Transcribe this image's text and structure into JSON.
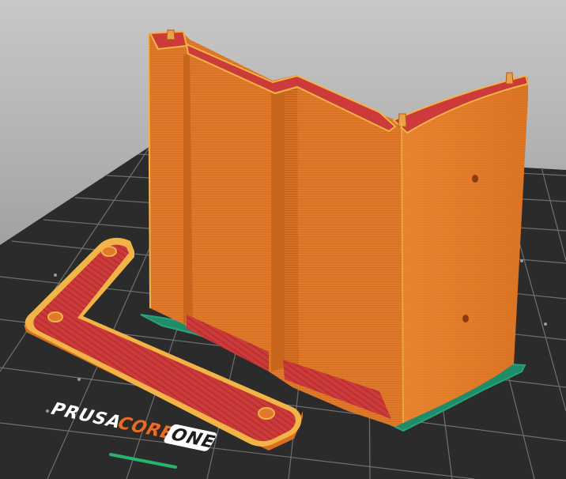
{
  "bed": {
    "brand": "PRUSA",
    "model": "CORE",
    "variant": "ONE"
  },
  "colors": {
    "background": "#b8b8b8",
    "bed_surface": "#2b2b2b",
    "bed_grid": "#7a7a7a",
    "model_perimeter": "#e07a2a",
    "model_infill": "#cc3a3a",
    "model_edge": "#f2b347",
    "skirt": "#1f8c6a",
    "logo_white": "#ffffff",
    "logo_orange": "#ed6b21",
    "status_line": "#27b36b"
  },
  "icons": {
    "bed-logo": "prusa-core-one-logo"
  }
}
